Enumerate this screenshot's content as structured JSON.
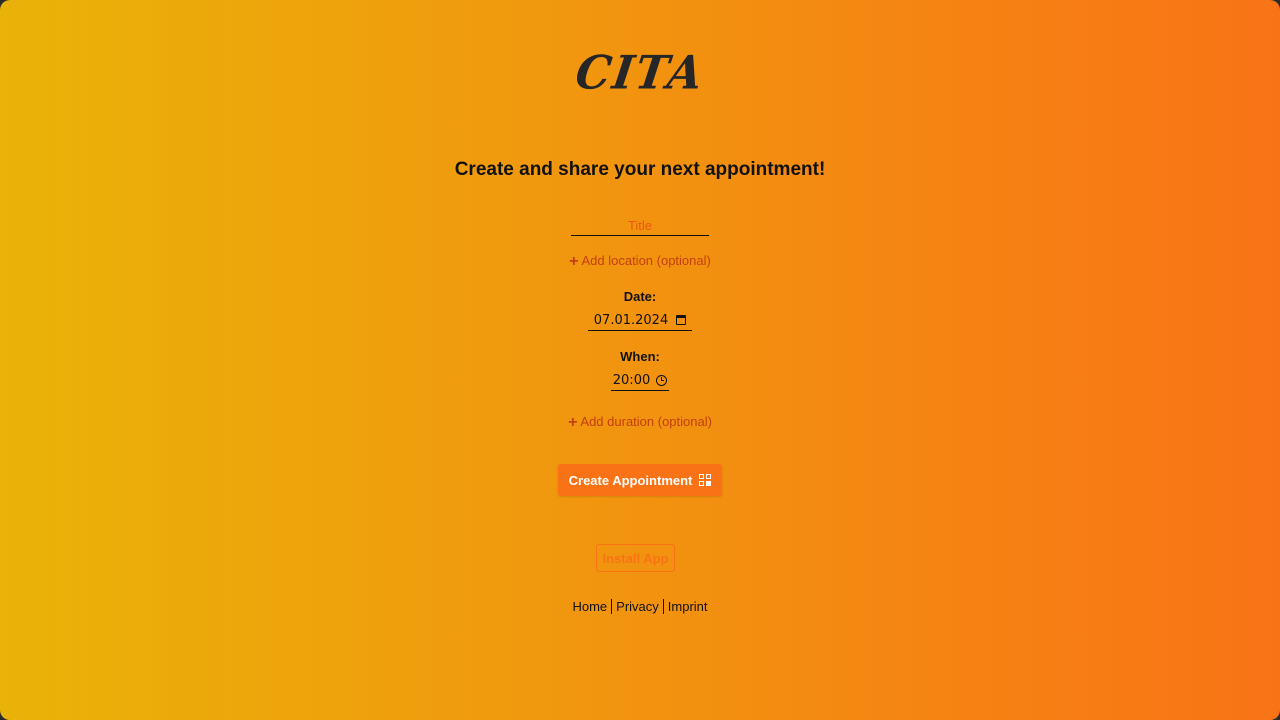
{
  "app": {
    "logo_text": "CITA"
  },
  "main": {
    "heading": "Create and share your next appointment!",
    "title_placeholder": "Title",
    "add_location_label": "Add location (optional)",
    "date_label": "Date:",
    "date_value": "07.01.2024",
    "time_label": "When:",
    "time_value": "20:00",
    "add_duration_label": "Add duration (optional)",
    "create_button_label": "Create Appointment",
    "install_button_label": "Install App"
  },
  "footer": {
    "links": [
      "Home",
      "Privacy",
      "Imprint"
    ]
  },
  "icons": {
    "plus": "plus-icon",
    "calendar": "calendar-icon",
    "clock": "clock-icon",
    "qr": "qr-code-icon"
  },
  "colors": {
    "gradient_start": "#eab308",
    "gradient_end": "#f97316",
    "accent": "#f97316",
    "link": "#c2410c"
  }
}
